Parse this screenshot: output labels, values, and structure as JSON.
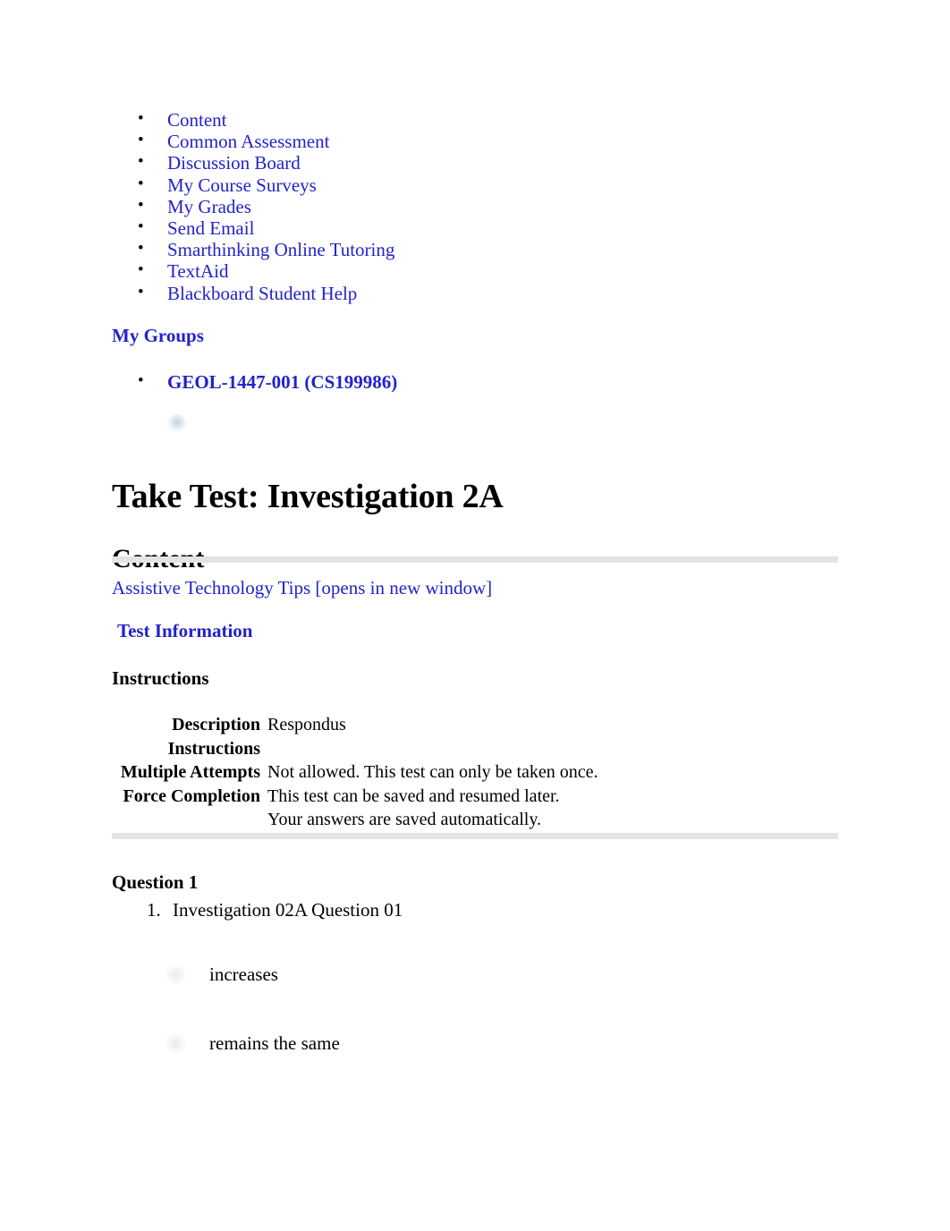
{
  "course_menu": {
    "items": [
      {
        "label": "Content"
      },
      {
        "label": "Common Assessment"
      },
      {
        "label": "Discussion Board"
      },
      {
        "label": "My Course Surveys"
      },
      {
        "label": "My Grades"
      },
      {
        "label": "Send Email"
      },
      {
        "label": "Smarthinking Online Tutoring"
      },
      {
        "label": "TextAid"
      },
      {
        "label": "Blackboard Student Help"
      }
    ]
  },
  "groups": {
    "heading": "My Groups",
    "items": [
      {
        "label": "GEOL-1447-001 (CS199986)"
      }
    ]
  },
  "page": {
    "title": "Take Test: Investigation 2A",
    "content_heading": "Content",
    "assistive_link": "Assistive Technology Tips [opens in new window]"
  },
  "test_information": {
    "heading": "Test Information",
    "instructions_heading": "Instructions",
    "rows": [
      {
        "label": "Description",
        "value": "Respondus"
      },
      {
        "label": "Instructions",
        "value": ""
      },
      {
        "label": "Multiple Attempts",
        "value": "Not allowed. This test can only be taken once."
      },
      {
        "label": "Force Completion",
        "value": "This test can be saved and resumed later."
      },
      {
        "label": "",
        "value": "Your answers are saved automatically."
      }
    ]
  },
  "question": {
    "heading": "Question 1",
    "text": "Investigation 02A Question 01",
    "options": [
      {
        "label": "increases"
      },
      {
        "label": "remains the same"
      }
    ]
  },
  "colors": {
    "link": "#2222CC",
    "text": "#000000",
    "rule": "#E4E4E4"
  }
}
